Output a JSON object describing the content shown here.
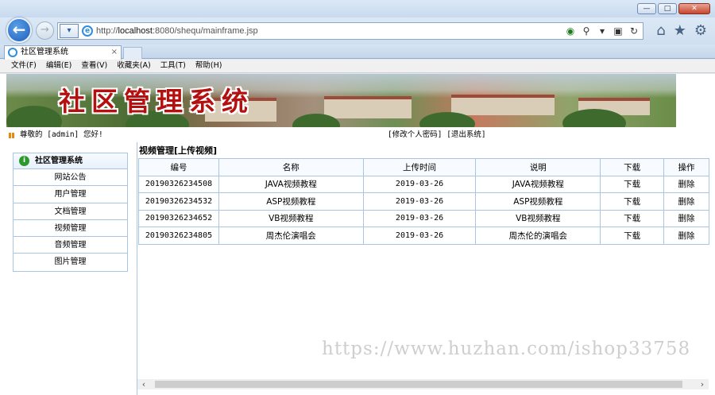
{
  "window": {
    "minimize": "—",
    "maximize": "□",
    "close": "✕"
  },
  "browser": {
    "back_icon": "←",
    "forward_icon": "→",
    "url_prefix": "http://",
    "url_host": "localhost",
    "url_rest": ":8080/shequ/mainframe.jsp",
    "tab_title": "社区管理系统",
    "tab_close": "×",
    "icons": {
      "compat": "compat-view-icon",
      "search": "search-icon",
      "rss": "rss-icon",
      "refresh": "refresh-icon",
      "home": "home-icon",
      "favorites": "star-icon",
      "tools": "gear-icon"
    }
  },
  "menubar": [
    "文件(F)",
    "编辑(E)",
    "查看(V)",
    "收藏夹(A)",
    "工具(T)",
    "帮助(H)"
  ],
  "banner": {
    "title": "社区管理系统"
  },
  "infobar": {
    "welcome": "尊敬的 [admin] 您好!",
    "change_password": "[修改个人密码]",
    "logout": "[退出系统]"
  },
  "sidebar": {
    "header": "社区管理系统",
    "items": [
      "网站公告",
      "用户管理",
      "文档管理",
      "视频管理",
      "音频管理",
      "图片管理"
    ]
  },
  "main": {
    "title": "视频管理[上传视频]",
    "columns": [
      "编号",
      "名称",
      "上传时间",
      "说明",
      "下载",
      "操作"
    ],
    "rows": [
      [
        "20190326234508",
        "JAVA视频教程",
        "2019-03-26",
        "JAVA视频教程",
        "下载",
        "删除"
      ],
      [
        "20190326234532",
        "ASP视频教程",
        "2019-03-26",
        "ASP视频教程",
        "下载",
        "删除"
      ],
      [
        "20190326234652",
        "VB视频教程",
        "2019-03-26",
        "VB视频教程",
        "下载",
        "删除"
      ],
      [
        "20190326234805",
        "周杰伦演唱会",
        "2019-03-26",
        "周杰伦的演唱会",
        "下载",
        "删除"
      ]
    ]
  },
  "watermark": "https://www.huzhan.com/ishop33758",
  "colors": {
    "border": "#a9c5e6",
    "banner_title": "#b51010",
    "accent": "#1f5fb7"
  }
}
